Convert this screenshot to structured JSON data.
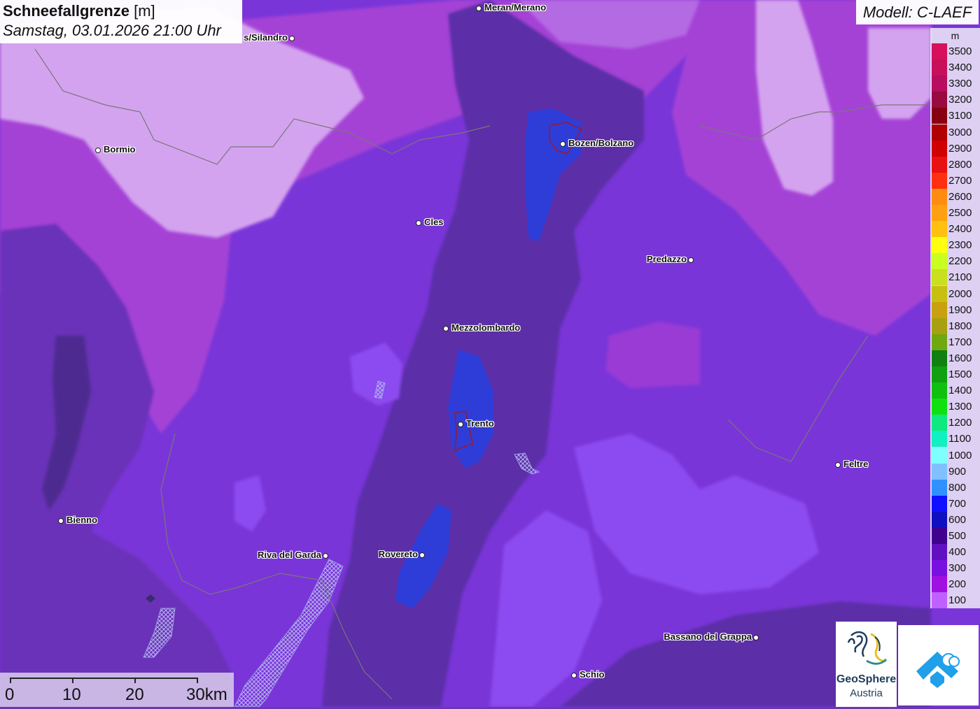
{
  "title": {
    "main": "Schneefallgrenze",
    "unit": "[m]",
    "datetime": "Samstag, 03.01.2026 21:00 Uhr"
  },
  "model": "Modell: C-LAEF",
  "legend": {
    "unit": "m",
    "entries": [
      {
        "label": "3500",
        "color": "#d6105a"
      },
      {
        "label": "3400",
        "color": "#c8105a"
      },
      {
        "label": "3300",
        "color": "#b80c5e"
      },
      {
        "label": "3200",
        "color": "#980a40"
      },
      {
        "label": "3100",
        "color": "#880010"
      },
      {
        "label": "3000",
        "color": "#b00000"
      },
      {
        "label": "2900",
        "color": "#d00000"
      },
      {
        "label": "2800",
        "color": "#e81010"
      },
      {
        "label": "2700",
        "color": "#ff3010"
      },
      {
        "label": "2600",
        "color": "#ff8c10"
      },
      {
        "label": "2500",
        "color": "#ffa010"
      },
      {
        "label": "2400",
        "color": "#ffc010"
      },
      {
        "label": "2300",
        "color": "#ffff10"
      },
      {
        "label": "2200",
        "color": "#c8ff20"
      },
      {
        "label": "2100",
        "color": "#c8e020"
      },
      {
        "label": "2000",
        "color": "#c8c010"
      },
      {
        "label": "1900",
        "color": "#c8a010"
      },
      {
        "label": "1800",
        "color": "#a8a010"
      },
      {
        "label": "1700",
        "color": "#70a810"
      },
      {
        "label": "1600",
        "color": "#108010"
      },
      {
        "label": "1500",
        "color": "#10a010"
      },
      {
        "label": "1400",
        "color": "#10c010"
      },
      {
        "label": "1300",
        "color": "#10e010"
      },
      {
        "label": "1200",
        "color": "#10e880"
      },
      {
        "label": "1100",
        "color": "#10f0c0"
      },
      {
        "label": "1000",
        "color": "#80ffff"
      },
      {
        "label": "900",
        "color": "#80c0ff"
      },
      {
        "label": "800",
        "color": "#3090ff"
      },
      {
        "label": "700",
        "color": "#1010ff"
      },
      {
        "label": "600",
        "color": "#1010c0"
      },
      {
        "label": "500",
        "color": "#400090"
      },
      {
        "label": "400",
        "color": "#6010c0"
      },
      {
        "label": "300",
        "color": "#7a10e0"
      },
      {
        "label": "200",
        "color": "#a010e0"
      },
      {
        "label": "100",
        "color": "#c060ff"
      }
    ]
  },
  "cities": [
    {
      "name": "Meran/Merano",
      "side": "right"
    },
    {
      "name": "s/Silandro",
      "side": "left"
    },
    {
      "name": "Bormio",
      "side": "right"
    },
    {
      "name": "Bozen/Bolzano",
      "side": "right"
    },
    {
      "name": "Cles",
      "side": "right"
    },
    {
      "name": "Predazzo",
      "side": "left"
    },
    {
      "name": "Mezzolombardo",
      "side": "right"
    },
    {
      "name": "Trento",
      "side": "right"
    },
    {
      "name": "Feltre",
      "side": "right"
    },
    {
      "name": "Bienno",
      "side": "right"
    },
    {
      "name": "Riva del Garda",
      "side": "left"
    },
    {
      "name": "Rovereto",
      "side": "left"
    },
    {
      "name": "Bassano del Grappa",
      "side": "left"
    },
    {
      "name": "Schio",
      "side": "right"
    }
  ],
  "scale": {
    "labels": [
      "0",
      "10",
      "20",
      "30km"
    ]
  },
  "logos": {
    "geosphere_line1": "GeoSphere",
    "geosphere_line2": "Austria"
  },
  "colors": {
    "light_lilac": "#d9a6f0",
    "lilac": "#b57ae8",
    "purple": "#8a3ff0",
    "violet": "#7a2fe0",
    "deep_purple": "#5b2e9e",
    "dark_purple": "#4a2a8a",
    "blue": "#2f3fd8",
    "magenta": "#b040d0"
  }
}
